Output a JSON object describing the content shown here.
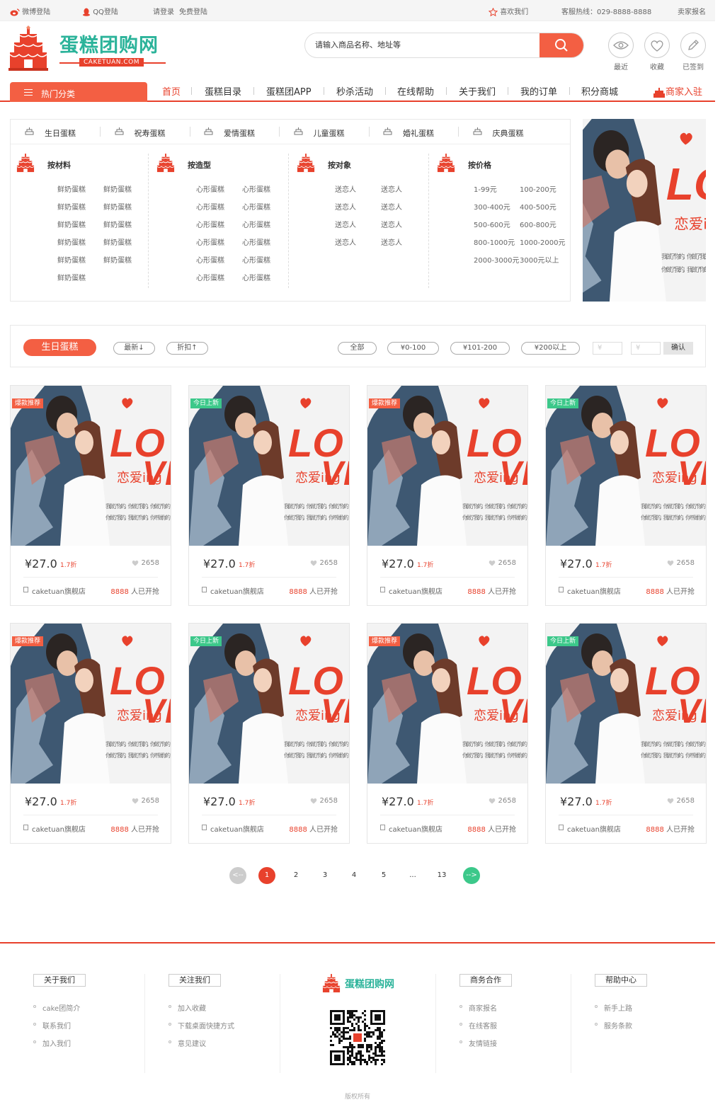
{
  "topbar": {
    "weibo": "微博登陆",
    "qq": "QQ登陆",
    "login": "请登录",
    "register": "免费登陆",
    "favorite": "喜欢我们",
    "hotline": "客服热线：029-8888-8888",
    "seller": "卖家报名"
  },
  "logo": {
    "name": "蛋糕团购网",
    "sub": "CAKETUAN.COM"
  },
  "search": {
    "placeholder": "请输入商品名称、地址等"
  },
  "header_actions": [
    {
      "label": "最近",
      "icon": "eye-icon"
    },
    {
      "label": "收藏",
      "icon": "heart-icon"
    },
    {
      "label": "已签到",
      "icon": "pencil-icon"
    }
  ],
  "nav": {
    "hot": "热门分类",
    "items": [
      "首页",
      "蛋糕目录",
      "蛋糕团APP",
      "秒杀活动",
      "在线帮助",
      "关于我们",
      "我的订单",
      "积分商城"
    ],
    "merchant": "商家入驻"
  },
  "top_categories": [
    "生日蛋糕",
    "祝寿蛋糕",
    "爱情蛋糕",
    "儿童蛋糕",
    "婚礼蛋糕",
    "庆典蛋糕"
  ],
  "groups": [
    {
      "title": "按材料",
      "items": [
        "鲜奶蛋糕",
        "鲜奶蛋糕",
        "鲜奶蛋糕",
        "鲜奶蛋糕",
        "鲜奶蛋糕",
        "鲜奶蛋糕",
        "鲜奶蛋糕",
        "鲜奶蛋糕",
        "鲜奶蛋糕",
        "鲜奶蛋糕",
        "鲜奶蛋糕"
      ]
    },
    {
      "title": "按造型",
      "items": [
        "心形蛋糕",
        "心形蛋糕",
        "心形蛋糕",
        "心形蛋糕",
        "心形蛋糕",
        "心形蛋糕",
        "心形蛋糕",
        "心形蛋糕",
        "心形蛋糕",
        "心形蛋糕",
        "心形蛋糕",
        "心形蛋糕"
      ]
    },
    {
      "title": "按对象",
      "items": [
        "送恋人",
        "送恋人",
        "送恋人",
        "送恋人",
        "送恋人",
        "送恋人",
        "送恋人",
        "送恋人"
      ]
    },
    {
      "title": "按价格",
      "items": [
        "1-99元",
        "100-200元",
        "300-400元",
        "400-500元",
        "500-600元",
        "600-800元",
        "800-1000元",
        "1000-2000元",
        "2000-3000元",
        "3000元以上"
      ]
    }
  ],
  "filter": {
    "category": "生日蛋糕",
    "sort_new": "最新↓",
    "sort_discount": "折扣↑",
    "ranges": [
      "全部",
      "¥0-100",
      "¥101-200",
      "¥200以上"
    ],
    "min_placeholder": "¥",
    "max_placeholder": "¥",
    "confirm": "确认"
  },
  "products": [
    {
      "badge": "爆款推荐",
      "price": "¥27.0",
      "discount": "1.7折",
      "likes": "2658",
      "shop": "caketuan旗舰店",
      "grabbed": "8888",
      "grab_suffix": "人已开抢"
    },
    {
      "badge": "今日上新",
      "price": "¥27.0",
      "discount": "1.7折",
      "likes": "2658",
      "shop": "caketuan旗舰店",
      "grabbed": "8888",
      "grab_suffix": "人已开抢"
    },
    {
      "badge": "爆款推荐",
      "price": "¥27.0",
      "discount": "1.7折",
      "likes": "2658",
      "shop": "caketuan旗舰店",
      "grabbed": "8888",
      "grab_suffix": "人已开抢"
    },
    {
      "badge": "今日上新",
      "price": "¥27.0",
      "discount": "1.7折",
      "likes": "2658",
      "shop": "caketuan旗舰店",
      "grabbed": "8888",
      "grab_suffix": "人已开抢"
    },
    {
      "badge": "爆款推荐",
      "price": "¥27.0",
      "discount": "1.7折",
      "likes": "2658",
      "shop": "caketuan旗舰店",
      "grabbed": "8888",
      "grab_suffix": "人已开抢"
    },
    {
      "badge": "今日上新",
      "price": "¥27.0",
      "discount": "1.7折",
      "likes": "2658",
      "shop": "caketuan旗舰店",
      "grabbed": "8888",
      "grab_suffix": "人已开抢"
    },
    {
      "badge": "爆款推荐",
      "price": "¥27.0",
      "discount": "1.7折",
      "likes": "2658",
      "shop": "caketuan旗舰店",
      "grabbed": "8888",
      "grab_suffix": "人已开抢"
    },
    {
      "badge": "今日上新",
      "price": "¥27.0",
      "discount": "1.7折",
      "likes": "2658",
      "shop": "caketuan旗舰店",
      "grabbed": "8888",
      "grab_suffix": "人已开抢"
    }
  ],
  "ad_image": {
    "love": "LOVE",
    "tag": "恋爱ing",
    "caption1": "我做了你的，你做了我的，你做了你的",
    "caption2": "你做了我的，我做了你的，你不做你的"
  },
  "pagination": {
    "prev": "<--",
    "pages": [
      "1",
      "2",
      "3",
      "4",
      "5",
      "...",
      "13"
    ],
    "next": "-->",
    "current": "1"
  },
  "footer": {
    "cols": [
      {
        "title": "关于我们",
        "links": [
          "cake团简介",
          "联系我们",
          "加入我们"
        ]
      },
      {
        "title": "关注我们",
        "links": [
          "加入收藏",
          "下载桌面快捷方式",
          "意见建议"
        ]
      },
      {
        "title": "商务合作",
        "links": [
          "商家报名",
          "在线客服",
          "友情链接"
        ]
      },
      {
        "title": "帮助中心",
        "links": [
          "新手上路",
          "服务条款"
        ]
      }
    ],
    "logo_name": "蛋糕团购网",
    "copyright": "版权所有"
  },
  "colors": {
    "accent": "#e8412c",
    "button": "#f35f43",
    "teal": "#2bb39a",
    "badge_hot": "#f35f43",
    "badge_new": "#3cc88a"
  }
}
